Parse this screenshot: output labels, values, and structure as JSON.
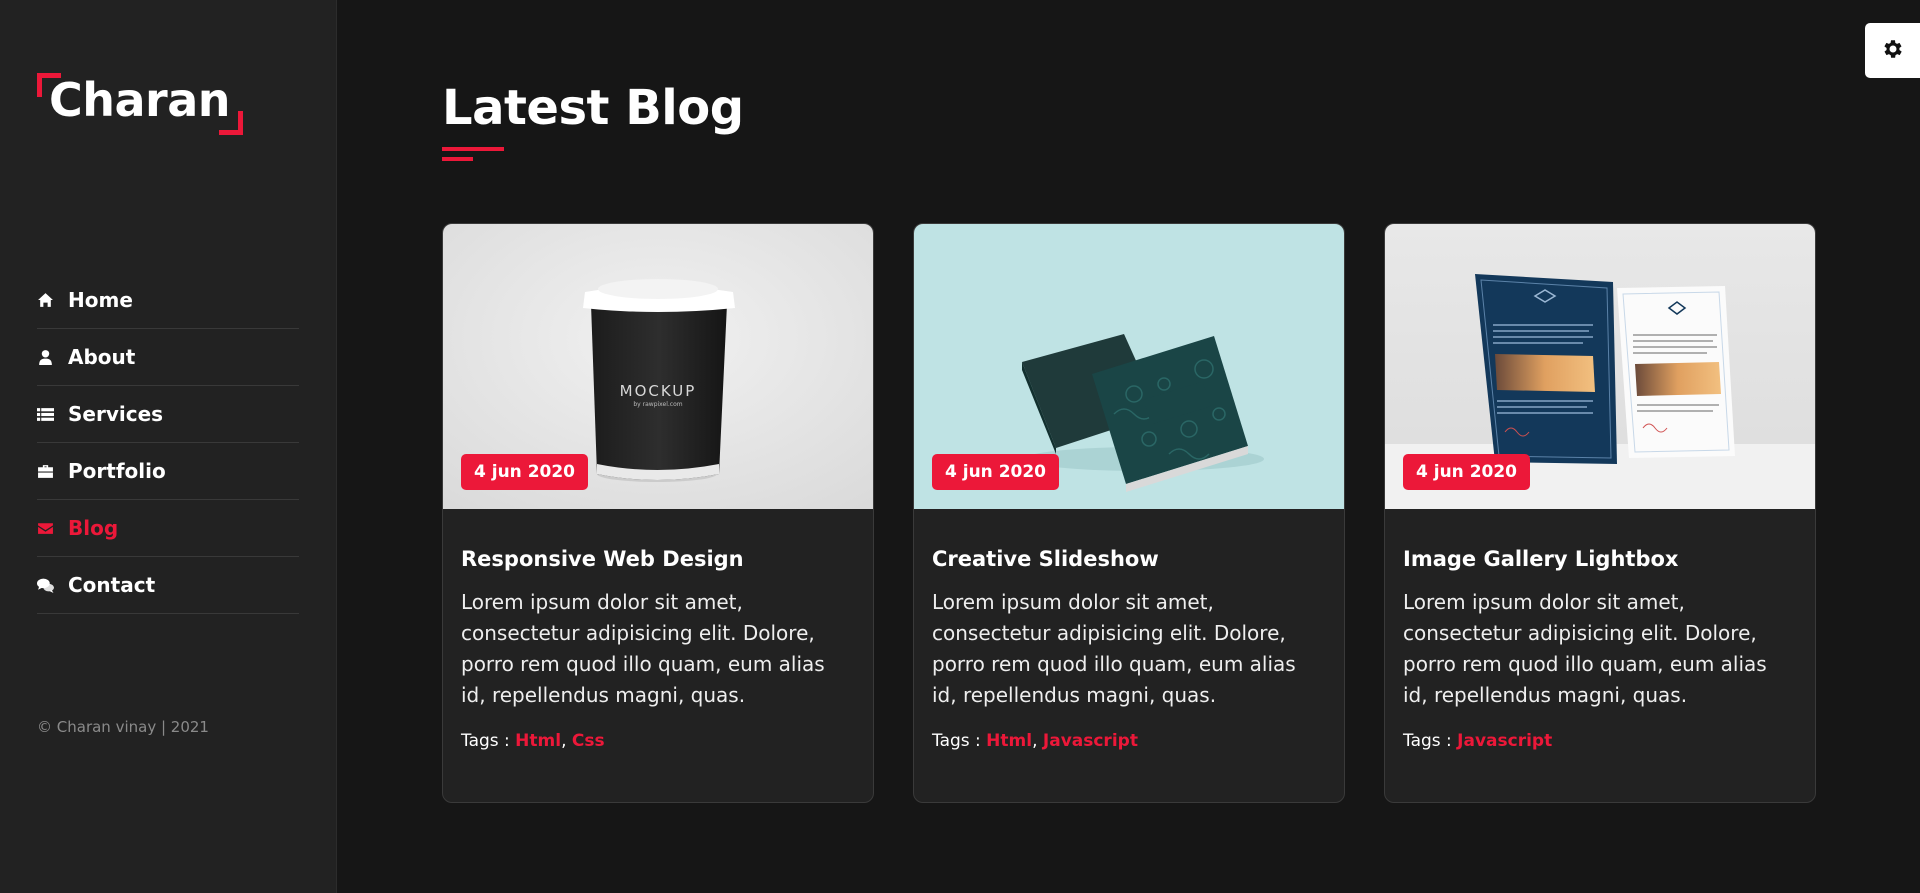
{
  "sidebar": {
    "logo": "Charan",
    "nav": [
      {
        "label": "Home",
        "icon": "home-icon"
      },
      {
        "label": "About",
        "icon": "user-icon"
      },
      {
        "label": "Services",
        "icon": "list-icon"
      },
      {
        "label": "Portfolio",
        "icon": "briefcase-icon"
      },
      {
        "label": "Blog",
        "icon": "envelope-icon",
        "active": true
      },
      {
        "label": "Contact",
        "icon": "comments-icon"
      }
    ],
    "copyright": "© Charan vinay | 2021"
  },
  "main": {
    "title": "Latest Blog",
    "cards": [
      {
        "date": "4 jun 2020",
        "title": "Responsive Web Design",
        "text": "Lorem ipsum dolor sit amet, consectetur adipisicing elit. Dolore, porro rem quod illo quam, eum alias id, repellendus magni, quas.",
        "tags_label": "Tags :",
        "tags": [
          "Html",
          "Css"
        ],
        "image": "coffee-cup-mockup",
        "image_text": "MOCKUP",
        "image_subtext": "by rawpixel.com"
      },
      {
        "date": "4 jun 2020",
        "title": "Creative Slideshow",
        "text": "Lorem ipsum dolor sit amet, consectetur adipisicing elit. Dolore, porro rem quod illo quam, eum alias id, repellendus magni, quas.",
        "tags_label": "Tags :",
        "tags": [
          "Html",
          "Javascript"
        ],
        "image": "book-mockup"
      },
      {
        "date": "4 jun 2020",
        "title": "Image Gallery Lightbox",
        "text": "Lorem ipsum dolor sit amet, consectetur adipisicing elit. Dolore, porro rem quod illo quam, eum alias id, repellendus magni, quas.",
        "tags_label": "Tags :",
        "tags": [
          "Javascript"
        ],
        "image": "letterhead-mockup"
      }
    ]
  },
  "colors": {
    "accent": "#ec1839",
    "background": "#161616",
    "sidebar": "#222222",
    "card": "#222222"
  },
  "settings_icon": "gear-icon"
}
